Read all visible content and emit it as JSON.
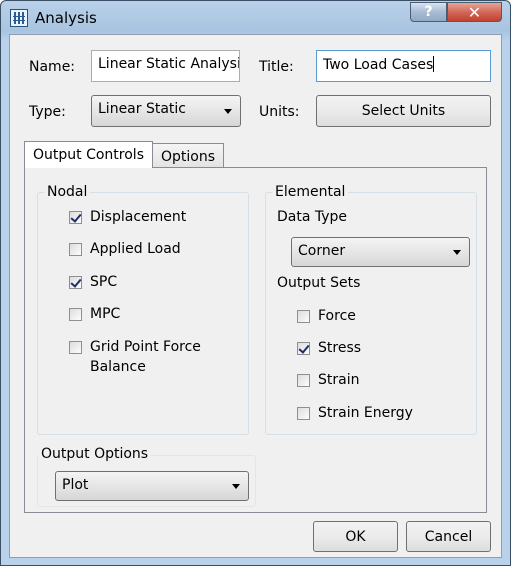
{
  "window": {
    "title": "Analysis",
    "help_glyph": "?",
    "close_glyph": "✕"
  },
  "form": {
    "name_label": "Name:",
    "name_value": "Linear Static Analysis",
    "title_label": "Title:",
    "title_value": "Two Load Cases",
    "type_label": "Type:",
    "type_value": "Linear Static",
    "units_label": "Units:",
    "units_button": "Select Units"
  },
  "tabs": [
    {
      "label": "Output Controls",
      "active": true
    },
    {
      "label": "Options",
      "active": false
    }
  ],
  "nodal": {
    "title": "Nodal",
    "items": [
      {
        "label": "Displacement",
        "checked": true
      },
      {
        "label": "Applied Load",
        "checked": false
      },
      {
        "label": "SPC",
        "checked": true
      },
      {
        "label": "MPC",
        "checked": false
      },
      {
        "label": "Grid Point Force",
        "label2": "Balance",
        "checked": false
      }
    ]
  },
  "elemental": {
    "title": "Elemental",
    "data_type_label": "Data Type",
    "data_type_value": "Corner",
    "output_sets_label": "Output Sets",
    "items": [
      {
        "label": "Force",
        "checked": false
      },
      {
        "label": "Stress",
        "checked": true
      },
      {
        "label": "Strain",
        "checked": false
      },
      {
        "label": "Strain Energy",
        "checked": false
      }
    ]
  },
  "output_options": {
    "title": "Output Options",
    "value": "Plot"
  },
  "footer": {
    "ok_label": "OK",
    "cancel_label": "Cancel"
  }
}
